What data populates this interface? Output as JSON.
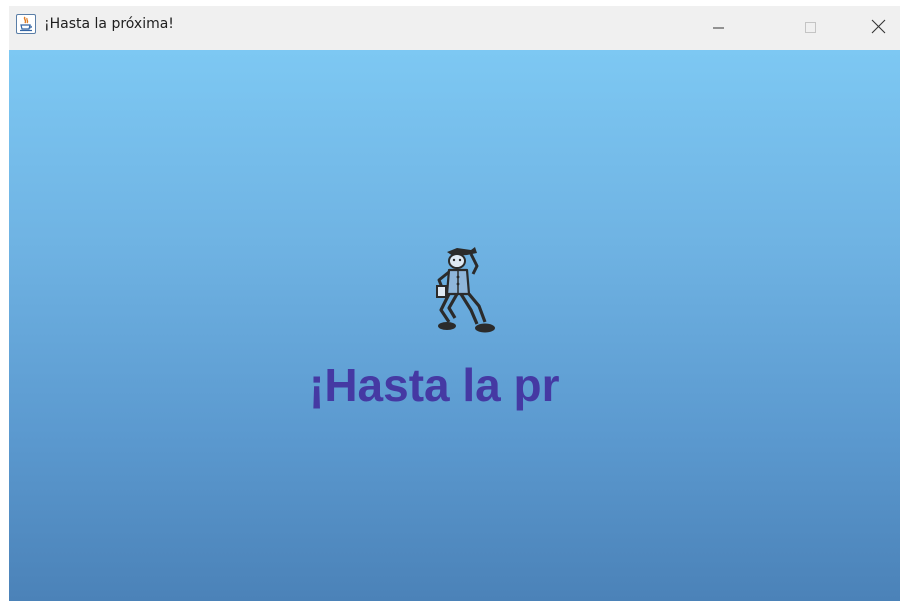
{
  "window": {
    "title": "¡Hasta la próxima!",
    "app_icon": "java-cup-icon",
    "controls": {
      "minimize_icon": "minimize-icon",
      "maximize_icon": "maximize-icon",
      "close_icon": "close-icon"
    }
  },
  "content": {
    "figure_icon": "dancing-man-icon",
    "message": "¡Hasta la pr",
    "background_top_color": "#7dc8f3",
    "background_bottom_color": "#4b82b8",
    "message_color": "#4539a3"
  }
}
